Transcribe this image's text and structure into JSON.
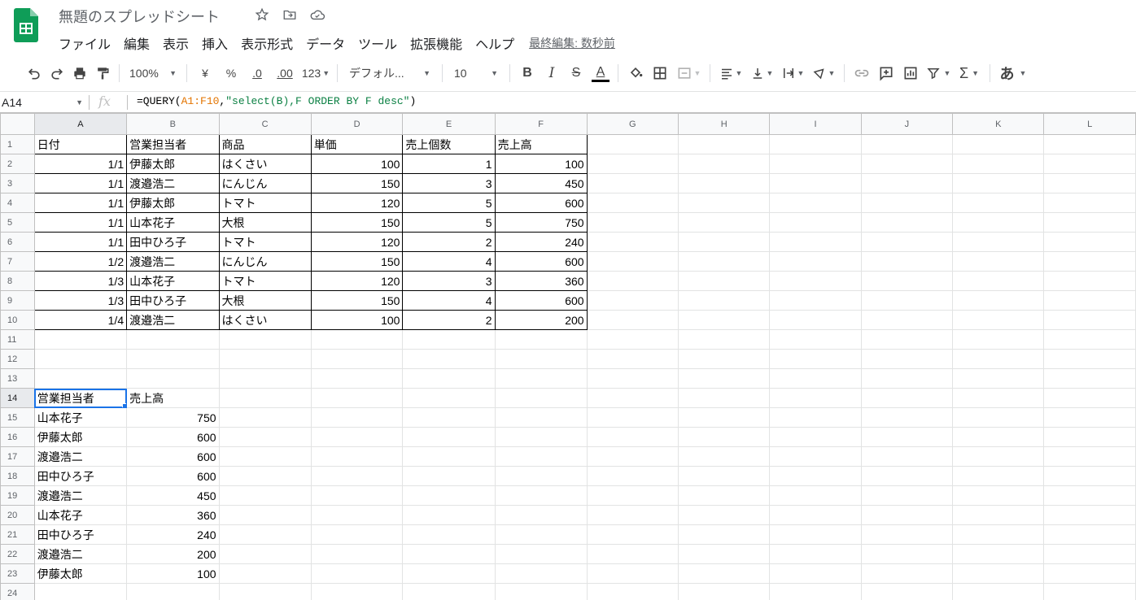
{
  "app": {
    "doc_title": "無題のスプレッドシート",
    "last_edit": "最終編集: 数秒前",
    "menu": [
      "ファイル",
      "編集",
      "表示",
      "挿入",
      "表示形式",
      "データ",
      "ツール",
      "拡張機能",
      "ヘルプ"
    ]
  },
  "toolbar": {
    "zoom": "100%",
    "currency": "¥",
    "percent": "%",
    "dec_decrease": ".0",
    "dec_increase": ".00",
    "more_formats": "123",
    "font": "デフォル...",
    "font_size": "10",
    "bold": "B",
    "italic": "I",
    "strike": "S",
    "text_color": "A",
    "sum": "Σ",
    "input_tools": "あ",
    "text_color_swatch": "#000000"
  },
  "formula_bar": {
    "name_box": "A14",
    "fx": "fx",
    "formula_prefix": "=QUERY(",
    "formula_range": "A1:F10",
    "formula_comma": ",",
    "formula_string": "\"select(B),F ORDER BY F desc\"",
    "formula_suffix": ")"
  },
  "grid": {
    "columns": [
      "A",
      "B",
      "C",
      "D",
      "E",
      "F",
      "G",
      "H",
      "I",
      "J",
      "K",
      "L"
    ],
    "active_cell": "A14",
    "selection_color": "#1a73e8",
    "rows": [
      {
        "n": "1",
        "cells": [
          "日付",
          "営業担当者",
          "商品",
          "単価",
          "売上個数",
          "売上高"
        ]
      },
      {
        "n": "2",
        "cells": [
          "1/1",
          "伊藤太郎",
          "はくさい",
          "100",
          "1",
          "100"
        ]
      },
      {
        "n": "3",
        "cells": [
          "1/1",
          "渡邉浩二",
          "にんじん",
          "150",
          "3",
          "450"
        ]
      },
      {
        "n": "4",
        "cells": [
          "1/1",
          "伊藤太郎",
          "トマト",
          "120",
          "5",
          "600"
        ]
      },
      {
        "n": "5",
        "cells": [
          "1/1",
          "山本花子",
          "大根",
          "150",
          "5",
          "750"
        ]
      },
      {
        "n": "6",
        "cells": [
          "1/1",
          "田中ひろ子",
          "トマト",
          "120",
          "2",
          "240"
        ]
      },
      {
        "n": "7",
        "cells": [
          "1/2",
          "渡邉浩二",
          "にんじん",
          "150",
          "4",
          "600"
        ]
      },
      {
        "n": "8",
        "cells": [
          "1/3",
          "山本花子",
          "トマト",
          "120",
          "3",
          "360"
        ]
      },
      {
        "n": "9",
        "cells": [
          "1/3",
          "田中ひろ子",
          "大根",
          "150",
          "4",
          "600"
        ]
      },
      {
        "n": "10",
        "cells": [
          "1/4",
          "渡邉浩二",
          "はくさい",
          "100",
          "2",
          "200"
        ]
      },
      {
        "n": "11",
        "cells": []
      },
      {
        "n": "12",
        "cells": []
      },
      {
        "n": "13",
        "cells": []
      },
      {
        "n": "14",
        "cells": [
          "営業担当者",
          "売上高"
        ]
      },
      {
        "n": "15",
        "cells": [
          "山本花子",
          "750"
        ]
      },
      {
        "n": "16",
        "cells": [
          "伊藤太郎",
          "600"
        ]
      },
      {
        "n": "17",
        "cells": [
          "渡邉浩二",
          "600"
        ]
      },
      {
        "n": "18",
        "cells": [
          "田中ひろ子",
          "600"
        ]
      },
      {
        "n": "19",
        "cells": [
          "渡邉浩二",
          "450"
        ]
      },
      {
        "n": "20",
        "cells": [
          "山本花子",
          "360"
        ]
      },
      {
        "n": "21",
        "cells": [
          "田中ひろ子",
          "240"
        ]
      },
      {
        "n": "22",
        "cells": [
          "渡邉浩二",
          "200"
        ]
      },
      {
        "n": "23",
        "cells": [
          "伊藤太郎",
          "100"
        ]
      },
      {
        "n": "24",
        "cells": []
      }
    ]
  }
}
